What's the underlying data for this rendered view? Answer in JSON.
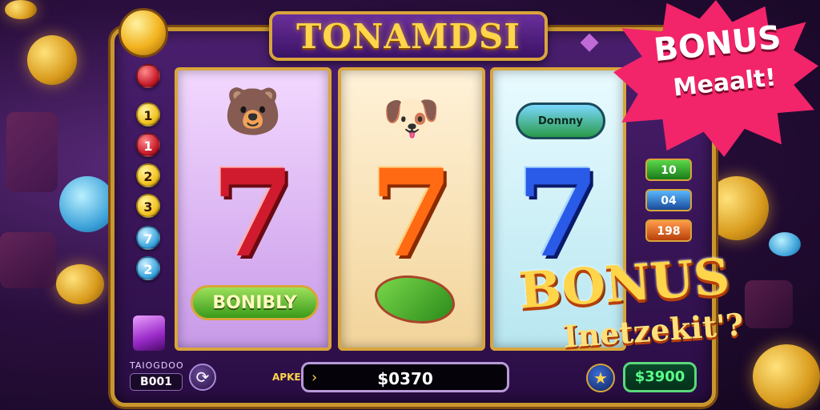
{
  "title": "TONAMDSI",
  "left_paylines": [
    "1",
    "1",
    "2",
    "3",
    "7",
    "2"
  ],
  "reels": [
    {
      "top_symbol": "bear-face",
      "middle_symbol": "7",
      "bottom_label": "BONIBLY"
    },
    {
      "top_symbol": "dog-face",
      "middle_symbol": "7",
      "bottom_symbol": "leaf"
    },
    {
      "top_label": "Donnny",
      "middle_symbol": "7"
    }
  ],
  "right_paylines": [
    "10",
    "04",
    "198"
  ],
  "burst": {
    "title": "BONUS",
    "subtitle": "Meaalt!"
  },
  "bonus_overlay": {
    "title": "BONUS",
    "subtitle": "Inetzekit'?"
  },
  "controls": {
    "credit_label": "TAIOGDOO",
    "credit_value": "B001",
    "bet_label": "APKE",
    "bet_value": "$0370",
    "win_value": "$3900"
  },
  "colors": {
    "accent_gold": "#d9a53a",
    "burst_pink": "#f2246a",
    "bonus_yellow": "#ffd54a"
  }
}
